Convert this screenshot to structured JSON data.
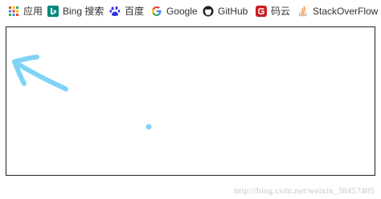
{
  "bookmarks": [
    {
      "label": "应用",
      "icon": "apps-grid-icon"
    },
    {
      "label": "Bing 搜索",
      "icon": "bing-icon"
    },
    {
      "label": "百度",
      "icon": "baidu-paw-icon"
    },
    {
      "label": "Google",
      "icon": "google-g-icon"
    },
    {
      "label": "GitHub",
      "icon": "github-octocat-icon"
    },
    {
      "label": "码云",
      "icon": "gitee-icon"
    },
    {
      "label": "StackOverFlow",
      "icon": "stackoverflow-icon"
    }
  ],
  "colors": {
    "arrow": "#7fd3f7",
    "dot": "#7fd3f7",
    "frame_border": "#222222",
    "bing": "#00897b",
    "baidu": "#2932e1",
    "gitee": "#c71d23",
    "stackoverflow": "#f48024"
  },
  "watermark": "http://blog.csdn.net/weixin_38457405"
}
